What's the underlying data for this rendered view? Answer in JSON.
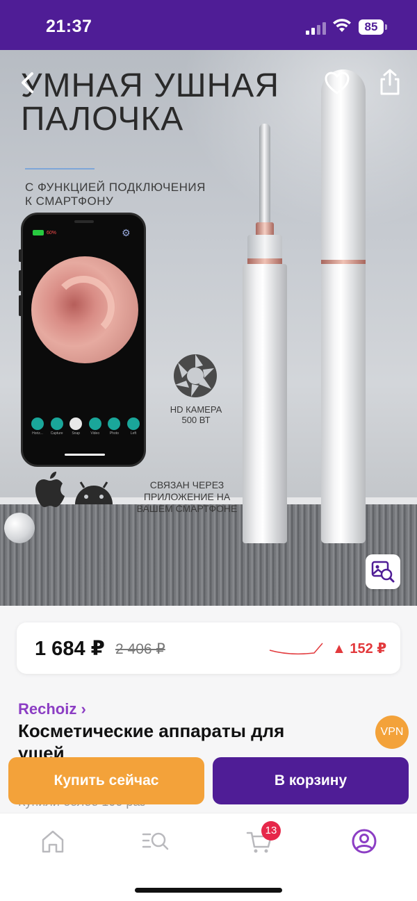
{
  "status_bar": {
    "time": "21:37",
    "battery": "85",
    "bg_color": "#4f1d96"
  },
  "hero": {
    "title_line1": "УМНАЯ УШНАЯ",
    "title_line2": "ПАЛОЧКА",
    "subtitle_line1": "С ФУНКЦИЕЙ ПОДКЛЮЧЕНИЯ",
    "subtitle_line2": "К СМАРТФОНУ",
    "phone_battery": "60%",
    "phone_tools": [
      "Horiz...",
      "Capture",
      "Snap",
      "Video",
      "Photo",
      "Left"
    ],
    "camera_label_line1": "HD КАМЕРА",
    "camera_label_line2": "500 ВТ",
    "connected_line1": "СВЯЗАН ЧЕРЕЗ",
    "connected_line2": "ПРИЛОЖЕНИЕ НА",
    "connected_line3": "ВАШЕМ СМАРТФОНЕ",
    "icons": [
      "back-icon",
      "heart-icon",
      "share-icon",
      "image-search-icon",
      "camera-aperture-icon",
      "apple-icon",
      "android-icon"
    ]
  },
  "price": {
    "current": "1 684 ₽",
    "old": "2 406 ₽",
    "change": "▲ 152 ₽",
    "change_color": "#e2393c"
  },
  "product": {
    "brand": "Rechoiz ›",
    "title": "Косметические аппараты для ушей",
    "bought": "Купили более 100 раз"
  },
  "vpn_badge": "VPN",
  "actions": {
    "buy_now": "Купить сейчас",
    "add_to_cart": "В корзину",
    "buy_color": "#f3a23a",
    "cart_color": "#4f1d96"
  },
  "tab_bar": {
    "icons": [
      "home-icon",
      "catalog-search-icon",
      "cart-icon",
      "profile-icon"
    ],
    "cart_badge": "13",
    "active_color": "#8c3ec4"
  }
}
